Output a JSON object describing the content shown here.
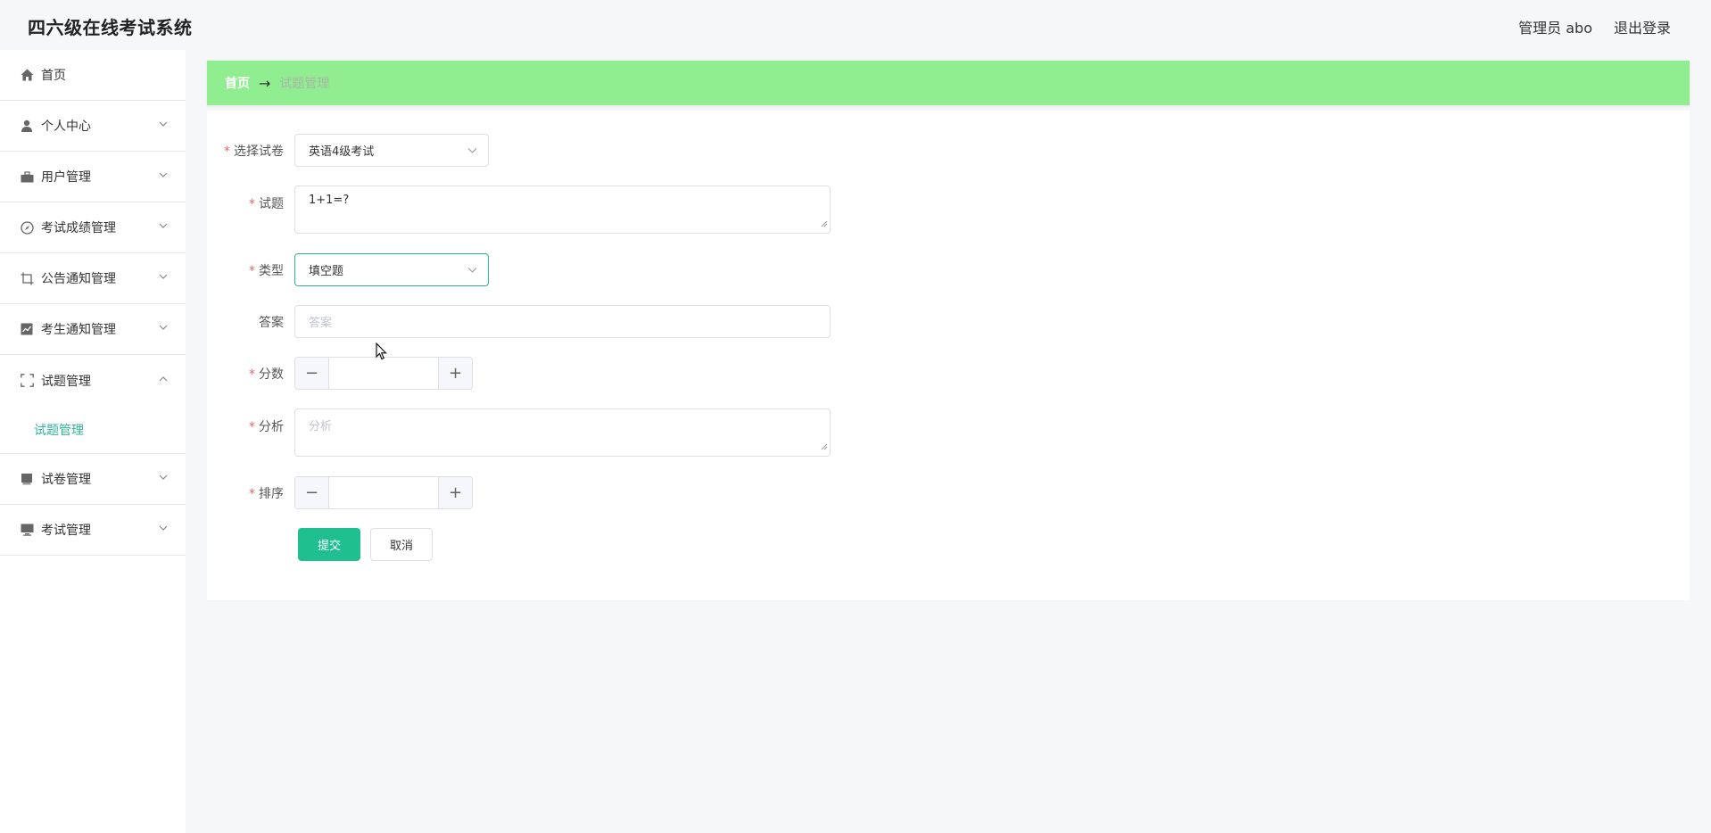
{
  "header": {
    "app_title": "四六级在线考试系统",
    "user_label": "管理员 abo",
    "logout_label": "退出登录"
  },
  "sidebar": {
    "items": [
      {
        "label": "首页",
        "icon": "home-icon",
        "chevron": false
      },
      {
        "label": "个人中心",
        "icon": "person-icon",
        "chevron": true
      },
      {
        "label": "用户管理",
        "icon": "briefcase-icon",
        "chevron": true
      },
      {
        "label": "考试成绩管理",
        "icon": "compass-icon",
        "chevron": true
      },
      {
        "label": "公告通知管理",
        "icon": "crop-icon",
        "chevron": true
      },
      {
        "label": "考生通知管理",
        "icon": "chart-icon",
        "chevron": true
      },
      {
        "label": "试题管理",
        "icon": "fullscreen-icon",
        "chevron": "up"
      },
      {
        "label": "试卷管理",
        "icon": "document-icon",
        "chevron": true
      },
      {
        "label": "考试管理",
        "icon": "monitor-icon",
        "chevron": true
      }
    ],
    "submenu": {
      "label": "试题管理"
    }
  },
  "breadcrumb": {
    "home": "首页",
    "separator": "→",
    "current": "试题管理"
  },
  "form": {
    "paper": {
      "label": "选择试卷",
      "value": "英语4级考试"
    },
    "question": {
      "label": "试题",
      "value": "1+1=?"
    },
    "type": {
      "label": "类型",
      "value": "填空题"
    },
    "answer": {
      "label": "答案",
      "placeholder": "答案"
    },
    "score": {
      "label": "分数",
      "minus": "−",
      "plus": "+"
    },
    "analysis": {
      "label": "分析",
      "placeholder": "分析"
    },
    "order": {
      "label": "排序",
      "minus": "−",
      "plus": "+"
    },
    "required_mark": "*",
    "submit_label": "提交",
    "cancel_label": "取消"
  },
  "colors": {
    "accent": "#30b39a",
    "breadcrumb_bg": "#90ee90",
    "submit_bg": "#1fbf90",
    "required": "#e26a6a"
  }
}
